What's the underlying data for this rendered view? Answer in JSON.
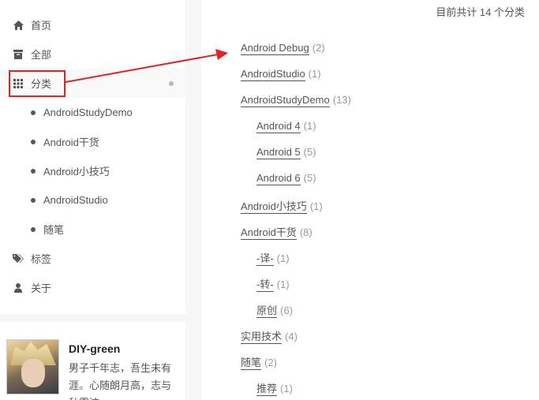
{
  "sidebar": {
    "menu": [
      {
        "label": "首页",
        "icon": "home-icon"
      },
      {
        "label": "全部",
        "icon": "archive-icon"
      },
      {
        "label": "分类",
        "icon": "grid-icon"
      },
      {
        "label": "标签",
        "icon": "tags-icon"
      },
      {
        "label": "关于",
        "icon": "user-icon"
      }
    ],
    "sub_items": [
      "AndroidStudyDemo",
      "Android干货",
      "Android小技巧",
      "AndroidStudio",
      "随笔"
    ]
  },
  "profile": {
    "name": "DIY-green",
    "bio": "男子千年志，吾生未有涯。心随朗月高，志与秋霜洁"
  },
  "main": {
    "total_text": "目前共计 14 个分类",
    "categories": [
      {
        "name": "Android Debug",
        "count": "(2)"
      },
      {
        "name": "AndroidStudio",
        "count": "(1)"
      },
      {
        "name": "AndroidStudyDemo",
        "count": "(13)"
      },
      {
        "name": "Android 4",
        "count": "(1)"
      },
      {
        "name": "Android 5",
        "count": "(5)"
      },
      {
        "name": "Android 6",
        "count": "(5)"
      },
      {
        "name": "Android小技巧",
        "count": "(1)"
      },
      {
        "name": "Android干货",
        "count": "(8)"
      },
      {
        "name": "-译-",
        "count": "(1)"
      },
      {
        "name": "-转-",
        "count": "(1)"
      },
      {
        "name": "原创",
        "count": "(6)"
      },
      {
        "name": "实用技术",
        "count": "(4)"
      },
      {
        "name": "随笔",
        "count": "(2)"
      },
      {
        "name": "推荐",
        "count": "(1)"
      }
    ]
  },
  "colors": {
    "annotation": "#e02424",
    "text": "#555555",
    "count": "#999999"
  }
}
